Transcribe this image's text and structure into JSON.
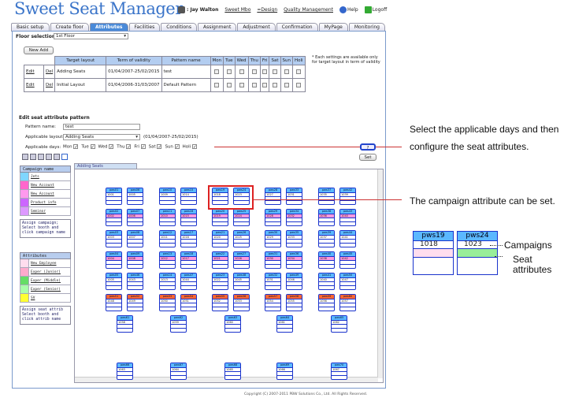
{
  "app": {
    "title": "Sweet Seat Manager",
    "user": ": Jay Walton",
    "links": [
      "Sweet Mbo",
      "=Design",
      "Quality Management"
    ],
    "help": "Help",
    "logoff": "Logoff",
    "copyright": "Copyright (C) 2007-2011 PBW Solutions Co., Ltd. All Rights Reserved."
  },
  "tabs": [
    "Basic setup",
    "Create floor",
    "Attributes",
    "Facilities",
    "Conditions",
    "Assignment",
    "Adjustment",
    "Confirmation",
    "MyPage",
    "Monitoring"
  ],
  "active_tab": "Attributes",
  "floor": {
    "label": "Floor selection",
    "value": "1st Floor"
  },
  "new_add": "New Add",
  "layout_table": {
    "headers": [
      "Target layout",
      "Term of validity",
      "Pattern name",
      "Mon",
      "Tue",
      "Wed",
      "Thu",
      "Fri",
      "Sat",
      "Sun",
      "Holi"
    ],
    "rows": [
      {
        "edit": "Edit",
        "del": "Del",
        "layout": "Adding Seats",
        "term": "01/04/2007-25/02/2015",
        "pattern": "test"
      },
      {
        "edit": "Edit",
        "del": "Del",
        "layout": "Initial Layout",
        "term": "01/04/2006-31/03/2007",
        "pattern": "Default Pattern"
      }
    ]
  },
  "note": "* Each settings are available only for target layout in term of validity",
  "edit": {
    "heading": "Edit seat attribute pattern",
    "pattern_label": "Pattern name:",
    "pattern_value": "test",
    "layout_label": "Applicable layout:",
    "layout_value": "Adding Seats",
    "layout_term": "(01/04/2007-25/02/2015)",
    "days_label": "Applicable days:",
    "days": [
      "Mon",
      "Tue",
      "Wed",
      "Thu",
      "Fri",
      "Sat",
      "Sun",
      "Holi"
    ]
  },
  "set_button": "Set",
  "canvas_tab": "Adding Seats",
  "campaign": {
    "heading": "Campaign name",
    "items": [
      {
        "label": "Jets",
        "color": "#7fd6ff"
      },
      {
        "label": "New Account",
        "color": "#ff66cc"
      },
      {
        "label": "New Account",
        "color": "#ff99ee"
      },
      {
        "label": "Product info",
        "color": "#cc66ff"
      },
      {
        "label": "Seminor",
        "color": "#dd99ff"
      }
    ],
    "msg": "Assign campaign; Select booth and click campaign name"
  },
  "attributes": {
    "heading": "Attributes",
    "items": [
      {
        "label": "New Employee",
        "color": "#ffddee"
      },
      {
        "label": "Exper (Junior)",
        "color": "#ffaacc"
      },
      {
        "label": "Exper (Middle)",
        "color": "#66dd66"
      },
      {
        "label": "Exper (Senior)",
        "color": "#aaffaa"
      },
      {
        "label": "SV",
        "color": "#ffff33"
      }
    ],
    "msg": "Assign seat attrib Select booth and click attrib name"
  },
  "annotations": {
    "a1": "Select the applicable days and then configure the seat attributes.",
    "a2": "The campaign attribute can be set."
  },
  "zoom": {
    "seats": [
      {
        "name": "pws19",
        "num": "1018"
      },
      {
        "name": "pws24",
        "num": "1023"
      }
    ],
    "campaigns": "Campaigns",
    "seat_attr": "Seat attributes"
  },
  "seat_rows": [
    {
      "names": [
        "pws01",
        "pws06",
        "pws10",
        "pws15",
        "pws19",
        "pws24",
        "pws28",
        "pws33",
        "pws37",
        "pws42"
      ],
      "nums": [
        "1001",
        "1005",
        "1009",
        "1014",
        "1018",
        "1023",
        "1027",
        "1031",
        "1035",
        "1039"
      ]
    },
    {
      "names": [
        "pws02",
        "pws07",
        "pws11",
        "pws16",
        "pws20",
        "pws25",
        "pws29",
        "pws34",
        "pws38",
        "pws43"
      ],
      "nums": [
        "1002",
        "1006",
        "1010",
        "1015",
        "1019",
        "1024",
        "1028",
        "1032",
        "1036",
        "1040"
      ]
    },
    {
      "names": [
        "pws03",
        "pws08",
        "pws12",
        "pws17",
        "pws21",
        "pws26",
        "pws30",
        "pws35",
        "pws39",
        "pws44"
      ],
      "nums": [
        "1003",
        "1007",
        "1011",
        "1016",
        "1020",
        "1025",
        "1029",
        "1033",
        "1037",
        "1041"
      ]
    },
    {
      "names": [
        "pws04",
        "pws09",
        "pws13",
        "pws18",
        "pws22",
        "pws27",
        "pws31",
        "pws36",
        "pws40",
        "pws45"
      ],
      "nums": [
        "1004",
        "1008",
        "1012",
        "1017",
        "1021",
        "1026",
        "1030",
        "1034",
        "1038",
        "1042"
      ]
    },
    {
      "names": [
        "pws05",
        "pws46",
        "pws14",
        "pws47",
        "pws23",
        "pws48",
        "pws32",
        "pws49",
        "pws41",
        "pws50"
      ],
      "nums": [
        "1005",
        "1043",
        "1013",
        "1044",
        "1022",
        "1045",
        "1031",
        "1046",
        "1040",
        "1047"
      ]
    },
    {
      "names": [
        "pws51",
        "pws52",
        "pws53",
        "pws54",
        "pws55",
        "pws56",
        "pws57",
        "pws58",
        "pws59",
        "pws60"
      ],
      "nums": [
        "1048",
        "1049",
        "1050",
        "1051",
        "1052",
        "1053",
        "1054",
        "1055",
        "1056",
        "1057"
      ]
    }
  ],
  "seat_row_colors": [
    "#ffffff",
    "#ff99dd",
    "#ffffff",
    "#ff99dd",
    "#ffffff",
    "#ffffff"
  ],
  "bottom_row": {
    "names": [
      "pws61",
      "pws62",
      "pws63",
      "pws64",
      "pws65"
    ],
    "nums": [
      "1058",
      "1059",
      "1060",
      "1061",
      "1062"
    ]
  },
  "last_row": {
    "names": [
      "pws66",
      "pws67",
      "pws68",
      "pws69",
      "pws70"
    ],
    "nums": [
      "1063",
      "1064",
      "1065",
      "1066",
      "1067"
    ]
  }
}
